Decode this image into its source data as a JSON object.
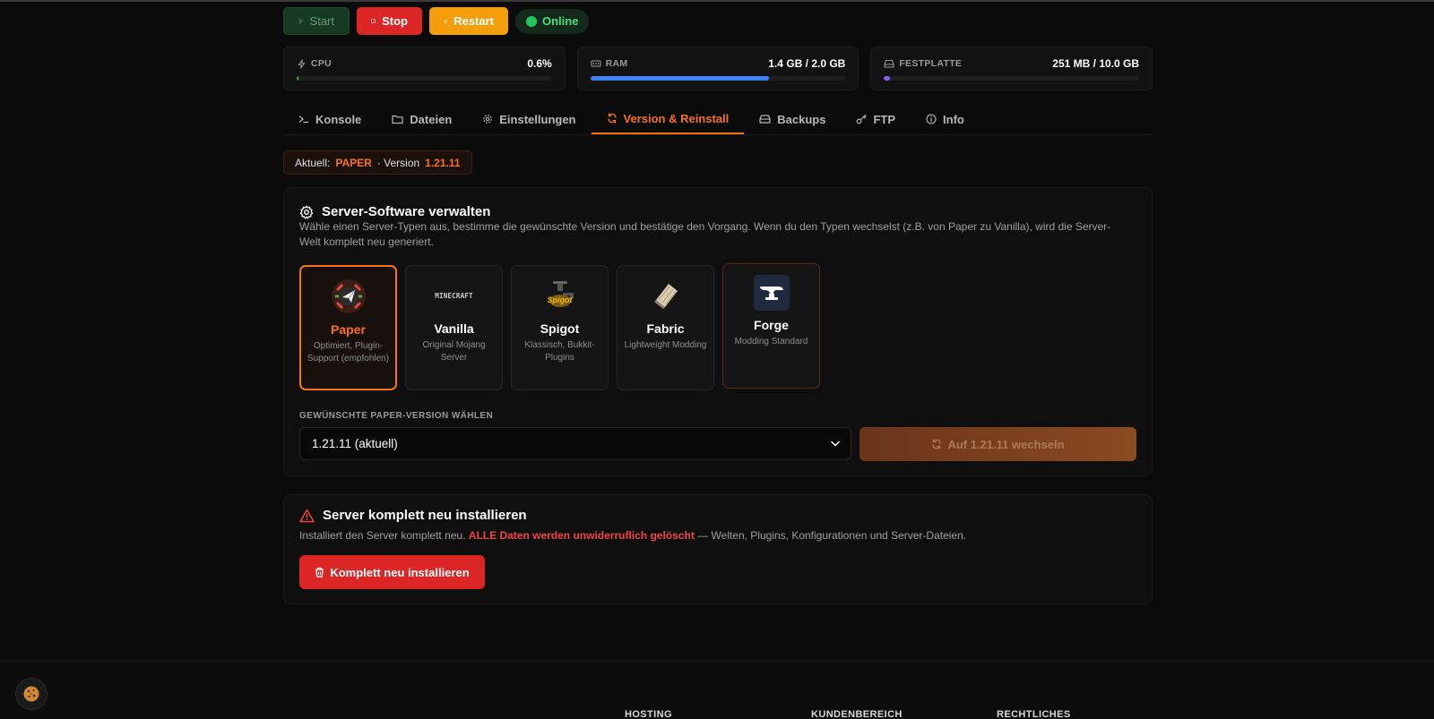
{
  "controls": {
    "start": "Start",
    "stop": "Stop",
    "restart": "Restart",
    "status": "Online"
  },
  "stats": {
    "cpu": {
      "label": "CPU",
      "value": "0.6%",
      "fill": 0.006,
      "color": "#22c55e"
    },
    "ram": {
      "label": "RAM",
      "value": "1.4 GB / 2.0 GB",
      "fill": 0.7,
      "color": "#3b82f6"
    },
    "disk": {
      "label": "FESTPLATTE",
      "value": "251 MB / 10.0 GB",
      "fill": 0.025,
      "color": "#8b5cf6"
    }
  },
  "tabs": [
    {
      "label": "Konsole",
      "icon": "terminal-icon"
    },
    {
      "label": "Dateien",
      "icon": "folder-icon"
    },
    {
      "label": "Einstellungen",
      "icon": "gear-icon"
    },
    {
      "label": "Version & Reinstall",
      "icon": "refresh-icon",
      "active": true
    },
    {
      "label": "Backups",
      "icon": "archive-icon"
    },
    {
      "label": "FTP",
      "icon": "key-icon"
    },
    {
      "label": "Info",
      "icon": "info-icon"
    }
  ],
  "current": {
    "prefix": "Aktuell:",
    "type": "PAPER",
    "version_prefix": "· Version",
    "version": "1.21.11"
  },
  "software": {
    "title": "Server-Software verwalten",
    "description": "Wähle einen Server-Typen aus, bestimme die gewünschte Version und bestätige den Vorgang. Wenn du den Typen wechselst (z.B. von Paper zu Vanilla), wird die Server-Welt komplett neu generiert.",
    "cards": [
      {
        "name": "Paper",
        "sub": "Optimiert, Plugin-Support (empfohlen)",
        "selected": true
      },
      {
        "name": "Vanilla",
        "sub": "Original Mojang Server",
        "logo_text": "MINECRAFT"
      },
      {
        "name": "Spigot",
        "sub": "Klassisch, Bukkit-Plugins",
        "logo_text": "Spigot"
      },
      {
        "name": "Fabric",
        "sub": "Lightweight Modding"
      },
      {
        "name": "Forge",
        "sub": "Modding Standard"
      }
    ],
    "version_label": "GEWÜNSCHTE PAPER-VERSION WÄHLEN",
    "version_selected": "1.21.11 (aktuell)",
    "switch_button": "Auf 1.21.11 wechseln"
  },
  "reinstall": {
    "title": "Server komplett neu installieren",
    "desc_before": "Installiert den Server komplett neu.",
    "desc_danger": "ALLE Daten werden unwiderruflich gelöscht",
    "desc_after": "— Welten, Plugins, Konfigurationen und Server-Dateien.",
    "button": "Komplett neu installieren"
  },
  "footer": {
    "col1": "HOSTING",
    "col2": "KUNDENBEREICH",
    "col3": "RECHTLICHES"
  }
}
